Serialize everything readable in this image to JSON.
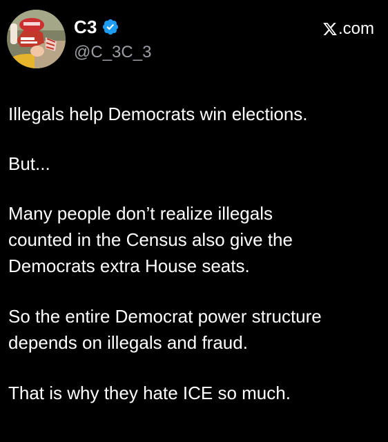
{
  "tweet": {
    "author": {
      "display_name": "C3",
      "handle": "@C_3C_3",
      "verified": true,
      "verified_icon": "verified-badge-icon",
      "avatar_icon": "profile-avatar"
    },
    "source": {
      "label": ".com",
      "icon": "x-logo-icon"
    },
    "paragraphs": [
      "Illegals help Democrats win elections.",
      "But...",
      "Many people don’t realize illegals\ncounted in the Census also give the\nDemocrats extra House seats.",
      "So the entire Democrat power structure\ndepends on illegals and fraud.",
      "That is why they hate ICE so much."
    ]
  },
  "colors": {
    "background": "#000000",
    "text": "#ffffff",
    "handle": "#9a9da2",
    "verified": "#1d9bf0"
  }
}
